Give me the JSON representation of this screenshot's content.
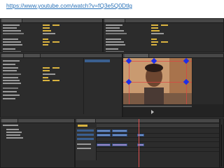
{
  "page": {
    "url": "https://www.youtube.com/watch?v=fQ3e5Q0Dtlg"
  },
  "colors": {
    "background": "#3c3c3c",
    "panel": "#2c2c2c",
    "value_text": "#d9b340",
    "selection": "#3a5f8f",
    "marker": "#1e2ee8",
    "clip_video": "#6f92c9",
    "clip_audio": "#9a88c8",
    "playhead": "#e05050",
    "link": "#2a72b8"
  },
  "icons": [
    "play-icon",
    "marker-icon",
    "playhead-icon"
  ]
}
